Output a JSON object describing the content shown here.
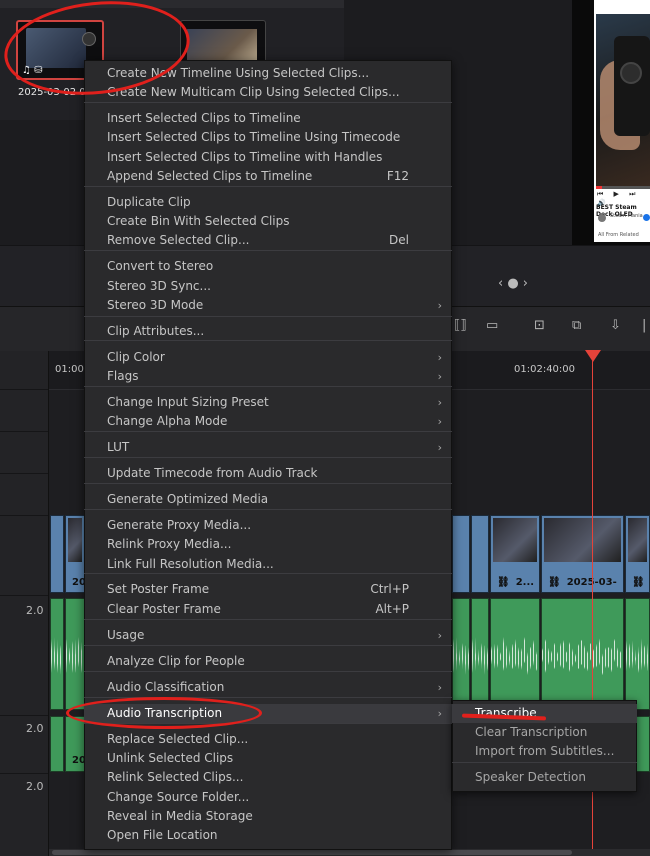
{
  "media_pool": {
    "clip_name": "2025-03-02 0",
    "clip_icons": "♫ ⛁"
  },
  "viewer": {
    "video_title": "BEST Steam Deck OLED",
    "channel": "Steam Mania",
    "controls": "⏮ ▶ ⏭ 🔊",
    "tags": "All  From  Related"
  },
  "pager": "‹ ● ›",
  "timeline": {
    "timecode_left": "01:00:",
    "timecode_right": "01:02:40:00",
    "track_volumes": [
      "2.0",
      "2.0",
      "2.0"
    ],
    "clip_labels": [
      "20",
      "20",
      "2...",
      "2025-03-",
      "20"
    ]
  },
  "context_menu": {
    "items": [
      {
        "label": "Create New Timeline Using Selected Clips..."
      },
      {
        "label": "Create New Multicam Clip Using Selected Clips..."
      },
      {
        "label": "Insert Selected Clips to Timeline"
      },
      {
        "label": "Insert Selected Clips to Timeline Using Timecode"
      },
      {
        "label": "Insert Selected Clips to Timeline with Handles"
      },
      {
        "label": "Append Selected Clips to Timeline",
        "shortcut": "F12"
      },
      {
        "label": "Duplicate Clip"
      },
      {
        "label": "Create Bin With Selected Clips"
      },
      {
        "label": "Remove Selected Clip...",
        "shortcut": "Del"
      },
      {
        "label": "Convert to Stereo"
      },
      {
        "label": "Stereo 3D Sync..."
      },
      {
        "label": "Stereo 3D Mode",
        "submenu": true
      },
      {
        "label": "Clip Attributes..."
      },
      {
        "label": "Clip Color",
        "submenu": true
      },
      {
        "label": "Flags",
        "submenu": true
      },
      {
        "label": "Change Input Sizing Preset",
        "submenu": true
      },
      {
        "label": "Change Alpha Mode",
        "submenu": true
      },
      {
        "label": "LUT",
        "submenu": true
      },
      {
        "label": "Update Timecode from Audio Track"
      },
      {
        "label": "Generate Optimized Media"
      },
      {
        "label": "Generate Proxy Media..."
      },
      {
        "label": "Relink Proxy Media..."
      },
      {
        "label": "Link Full Resolution Media..."
      },
      {
        "label": "Set Poster Frame",
        "shortcut": "Ctrl+P"
      },
      {
        "label": "Clear Poster Frame",
        "shortcut": "Alt+P"
      },
      {
        "label": "Usage",
        "submenu": true
      },
      {
        "label": "Analyze Clip for People"
      },
      {
        "label": "Audio Classification",
        "submenu": true
      },
      {
        "label": "Audio Transcription",
        "submenu": true,
        "highlighted": true
      },
      {
        "label": "Replace Selected Clip..."
      },
      {
        "label": "Unlink Selected Clips"
      },
      {
        "label": "Relink Selected Clips..."
      },
      {
        "label": "Change Source Folder..."
      },
      {
        "label": "Reveal in Media Storage"
      },
      {
        "label": "Open File Location"
      }
    ],
    "submenu_arrow": "›"
  },
  "submenu": {
    "items": [
      {
        "label": "Transcribe",
        "highlighted": true
      },
      {
        "label": "Clear Transcription"
      },
      {
        "label": "Import from Subtitles..."
      },
      {
        "label": "Speaker Detection"
      }
    ]
  },
  "colors": {
    "annotation_red": "#e0201c",
    "video_clip_blue": "#5a82ad",
    "audio_clip_green": "#3f9a5a",
    "playhead_red": "#e5433a"
  }
}
